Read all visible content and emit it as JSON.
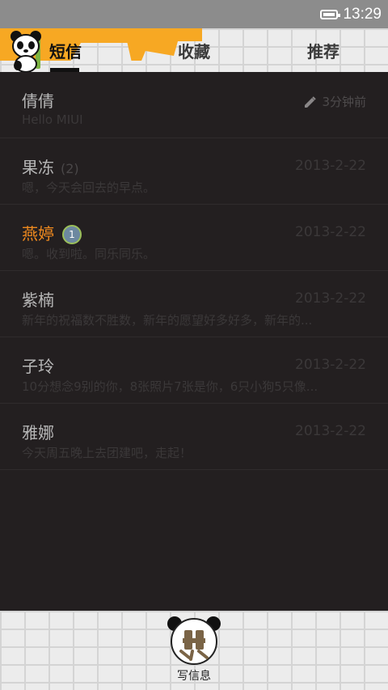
{
  "status_bar": {
    "time": "13:29",
    "battery_icon": "battery-icon"
  },
  "tabs": [
    {
      "label": "短信",
      "active": true
    },
    {
      "label": "收藏",
      "active": false
    },
    {
      "label": "推荐",
      "active": false
    }
  ],
  "conversations": [
    {
      "name": "倩倩",
      "preview": "Hello MIUI",
      "time": "3分钟前",
      "draft_icon": "pencil-icon"
    },
    {
      "name": "果冻",
      "count": "(2)",
      "preview": "嗯，今天会回去的早点。",
      "time": "2013-2-22"
    },
    {
      "name": "燕婷",
      "unread_badge": "1",
      "preview": "嗯。收到啦。同乐同乐。",
      "time": "2013-2-22"
    },
    {
      "name": "紫楠",
      "preview": "新年的祝福数不胜数，新年的愿望好多好多，新年的...",
      "time": "2013-2-22"
    },
    {
      "name": "子玲",
      "preview": "10分想念9别的你，8张照片7张是你，6只小狗5只像...",
      "time": "2013-2-22"
    },
    {
      "name": "雅娜",
      "preview": "今天周五晚上去团建吧，走起！",
      "time": "2013-2-22"
    }
  ],
  "compose": {
    "label": "写信息",
    "icon": "panda-compose-icon"
  },
  "colors": {
    "background": "#231f20",
    "accent": "#f7a823",
    "unread": "#f08a1e"
  }
}
